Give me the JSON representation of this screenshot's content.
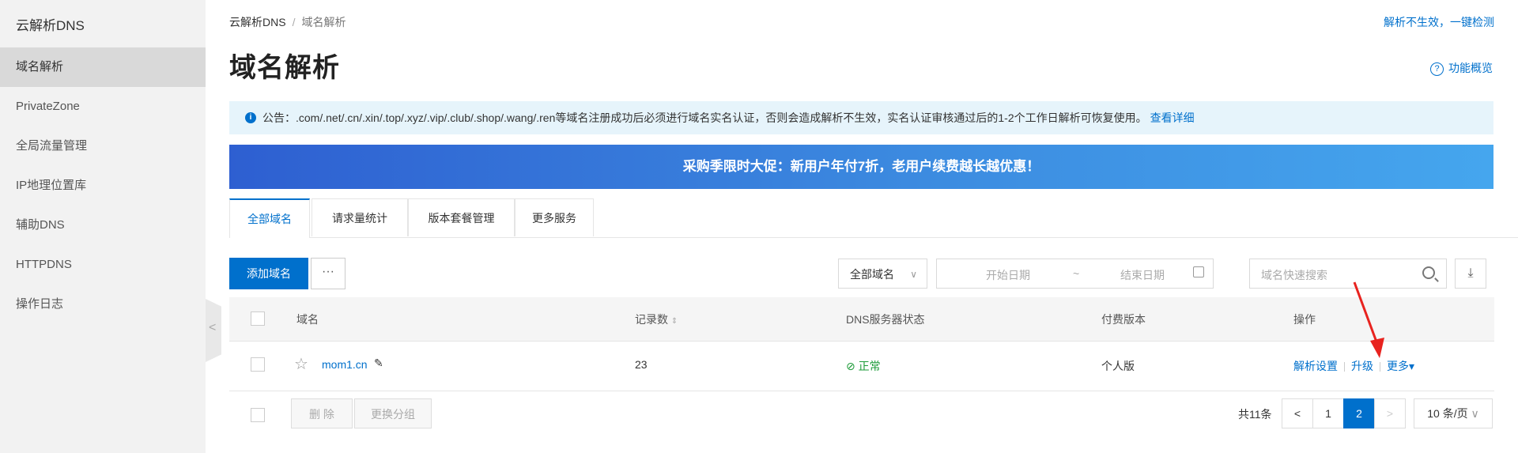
{
  "sidebar": {
    "title": "云解析DNS",
    "items": [
      {
        "label": "域名解析",
        "active": true
      },
      {
        "label": "PrivateZone"
      },
      {
        "label": "全局流量管理"
      },
      {
        "label": "IP地理位置库"
      },
      {
        "label": "辅助DNS"
      },
      {
        "label": "HTTPDNS"
      },
      {
        "label": "操作日志"
      }
    ],
    "collapse_glyph": "<"
  },
  "breadcrumb": {
    "root": "云解析DNS",
    "separator": "/",
    "current": "域名解析"
  },
  "header": {
    "check_link": "解析不生效，一键检测",
    "title": "域名解析",
    "overview_label": "功能概览"
  },
  "notice": {
    "text": "公告：.com/.net/.cn/.xin/.top/.xyz/.vip/.club/.shop/.wang/.ren等域名注册成功后必须进行域名实名认证，否则会造成解析不生效，实名认证审核通过后的1-2个工作日解析可恢复使用。",
    "link": "查看详细"
  },
  "banner": {
    "text": "采购季限时大促：新用户年付7折，老用户续费越长越优惠！"
  },
  "tabs": [
    {
      "label": "全部域名",
      "active": true
    },
    {
      "label": "请求量统计"
    },
    {
      "label": "版本套餐管理"
    },
    {
      "label": "更多服务"
    }
  ],
  "toolbar": {
    "add_label": "添加域名",
    "more_label": "···",
    "group_select": "全部域名",
    "start_date_placeholder": "开始日期",
    "range_sep": "~",
    "end_date_placeholder": "结束日期",
    "search_placeholder": "域名快速搜索"
  },
  "table": {
    "columns": [
      "域名",
      "记录数",
      "DNS服务器状态",
      "付费版本",
      "操作"
    ],
    "rows": [
      {
        "domain": "mom1.cn",
        "records": "23",
        "dns_status": "正常",
        "plan": "个人版",
        "actions": [
          "解析设置",
          "升级",
          "更多"
        ]
      }
    ]
  },
  "footer": {
    "delete_label": "删 除",
    "regroup_label": "更换分组",
    "total": "共11条",
    "pages": [
      "1",
      "2"
    ],
    "current_page": "2",
    "page_size": "10 条/页"
  },
  "colors": {
    "accent": "#0070cc",
    "ok": "#1c9b38",
    "annotation_arrow": "#e8231f"
  }
}
